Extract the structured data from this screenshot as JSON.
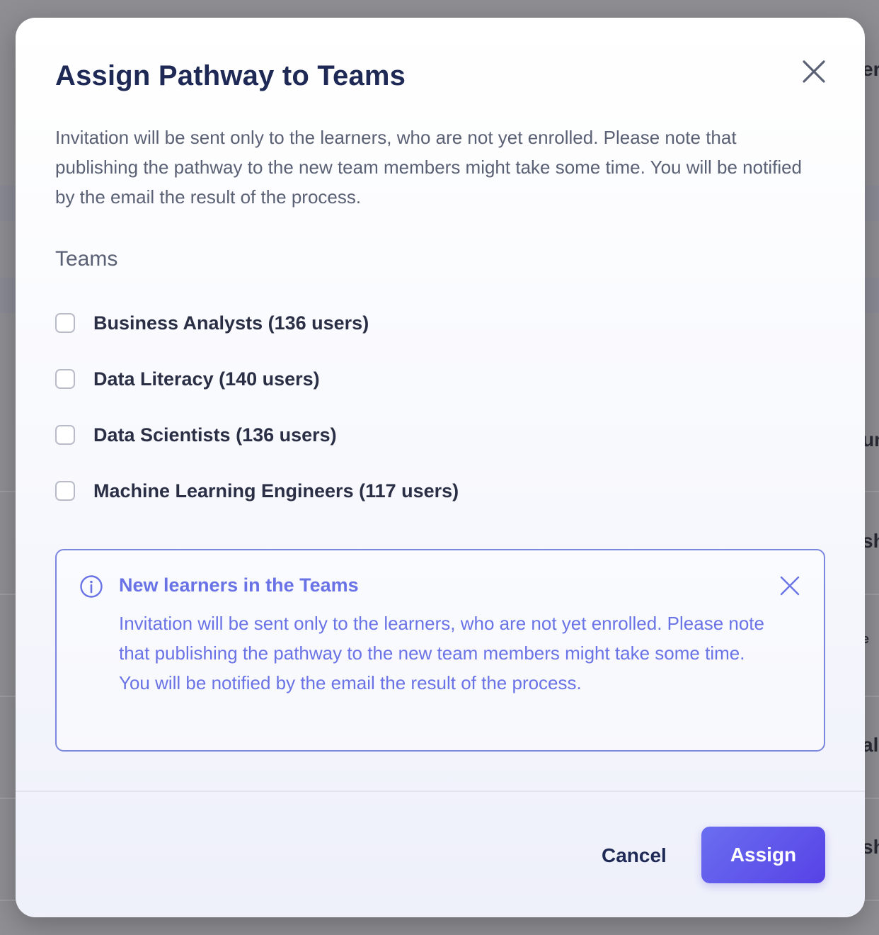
{
  "background": {
    "fragments": [
      "er",
      "un",
      "sh",
      "e",
      "alo",
      "sh"
    ]
  },
  "modal": {
    "title": "Assign Pathway to Teams",
    "intro": "Invitation will be sent only to the learners, who are not yet enrolled. Please note that publishing the pathway to the new team members might take some time. You will be notified by the email the result of the process.",
    "teams_label": "Teams",
    "teams": [
      {
        "label": "Business Analysts (136 users)",
        "checked": false
      },
      {
        "label": "Data Literacy (140 users)",
        "checked": false
      },
      {
        "label": "Data Scientists (136 users)",
        "checked": false
      },
      {
        "label": "Machine Learning Engineers (117 users)",
        "checked": false
      }
    ],
    "info": {
      "title": "New learners in the Teams",
      "text": "Invitation will be sent only to the learners, who are not yet enrolled. Please note that publishing the pathway to the new team members might take some time. You will be notified by the email the result of the process."
    },
    "cancel_label": "Cancel",
    "assign_label": "Assign"
  },
  "colors": {
    "accent": "#6a73e6",
    "title": "#1e2a55",
    "assign_start": "#6a6ef0",
    "assign_end": "#5742e6"
  }
}
